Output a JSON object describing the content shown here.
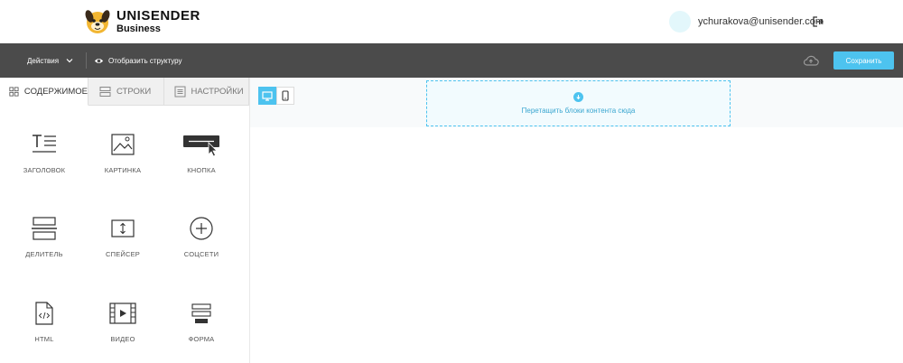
{
  "brand": {
    "title": "UNISENDER",
    "subtitle": "Business"
  },
  "user": {
    "email": "ychurakova@unisender.com"
  },
  "toolbar": {
    "actions_label": "Действия",
    "structure_label": "Отобразить структуру",
    "save_label": "Сохранить"
  },
  "tabs": [
    {
      "label": "СОДЕРЖИМОЕ"
    },
    {
      "label": "СТРОКИ"
    },
    {
      "label": "НАСТРОЙКИ"
    }
  ],
  "blocks": [
    {
      "label": "ЗАГОЛОВОК",
      "icon": "heading-icon"
    },
    {
      "label": "КАРТИНКА",
      "icon": "image-icon"
    },
    {
      "label": "КНОПКА",
      "icon": "button-icon"
    },
    {
      "label": "ДЕЛИТЕЛЬ",
      "icon": "divider-icon"
    },
    {
      "label": "СПЕЙСЕР",
      "icon": "spacer-icon"
    },
    {
      "label": "СОЦСЕТИ",
      "icon": "social-icon"
    },
    {
      "label": "HTML",
      "icon": "html-icon"
    },
    {
      "label": "ВИДЕО",
      "icon": "video-icon"
    },
    {
      "label": "ФОРМА",
      "icon": "form-icon"
    }
  ],
  "canvas": {
    "drop_text": "Перетащить блоки контента сюда"
  },
  "colors": {
    "accent": "#4dc3ef",
    "toolbar": "#4b4b4b"
  }
}
